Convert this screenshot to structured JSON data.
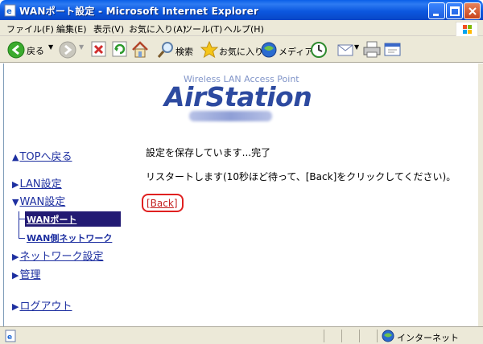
{
  "window": {
    "title": "WANポート設定 - Microsoft Internet Explorer"
  },
  "menu": {
    "items": [
      "ファイル(F)",
      "編集(E)",
      "表示(V)",
      "お気に入り(A)",
      "ツール(T)",
      "ヘルプ(H)"
    ]
  },
  "toolbar": {
    "back_label": "戻る",
    "search_label": "検索",
    "favorites_label": "お気に入り",
    "media_label": "メディア"
  },
  "logo": {
    "subtitle": "Wireless LAN Access Point",
    "brand": "AirStation"
  },
  "nav": {
    "top": "TOPへ戻る",
    "lan": "LAN設定",
    "wan": "WAN設定",
    "wan_port": "WANポート",
    "wan_network": "WAN側ネットワーク",
    "network": "ネットワーク設定",
    "admin": "管理",
    "logout": "ログアウト"
  },
  "main": {
    "saving_message": "設定を保存しています...完了",
    "restart_message": "リスタートします(10秒ほど待って、[Back]をクリックしてください)。",
    "back_link": "[Back]"
  },
  "status": {
    "zone": "インターネット"
  },
  "colors": {
    "link": "#1d2fa0",
    "active_nav_bg": "#221a73",
    "back_border": "#e02020",
    "brand": "#2d4aa0"
  }
}
